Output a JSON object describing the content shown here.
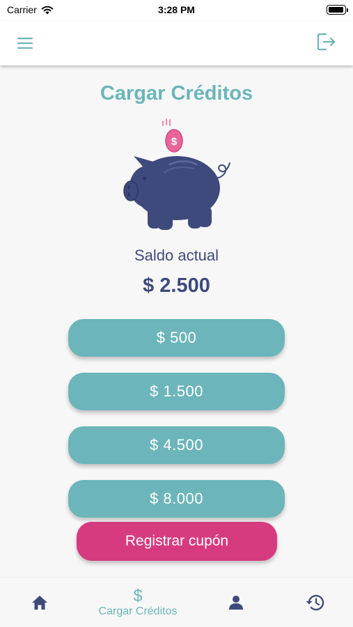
{
  "status_bar": {
    "carrier": "Carrier",
    "time": "3:28 PM"
  },
  "app_bar": {
    "menu_icon": "hamburger-menu-icon",
    "logout_icon": "logout-icon"
  },
  "page": {
    "title": "Cargar Créditos",
    "illustration": "piggy-bank",
    "balance_label": "Saldo actual",
    "balance_value": "$ 2.500"
  },
  "amount_options": [
    "$ 500",
    "$ 1.500",
    "$ 4.500",
    "$ 8.000"
  ],
  "coupon_button": {
    "label": "Registrar cupón"
  },
  "bottom_nav": {
    "items": [
      {
        "icon": "home-icon",
        "label": ""
      },
      {
        "icon": "dollar-icon",
        "label": "Cargar Créditos",
        "active": true
      },
      {
        "icon": "person-icon",
        "label": ""
      },
      {
        "icon": "history-icon",
        "label": ""
      }
    ]
  },
  "colors": {
    "accent": "#6cb5ba",
    "primary_dark": "#3e4a7c",
    "coupon": "#d63b7f",
    "coin": "#e8679a",
    "background": "#f7f7f7"
  }
}
